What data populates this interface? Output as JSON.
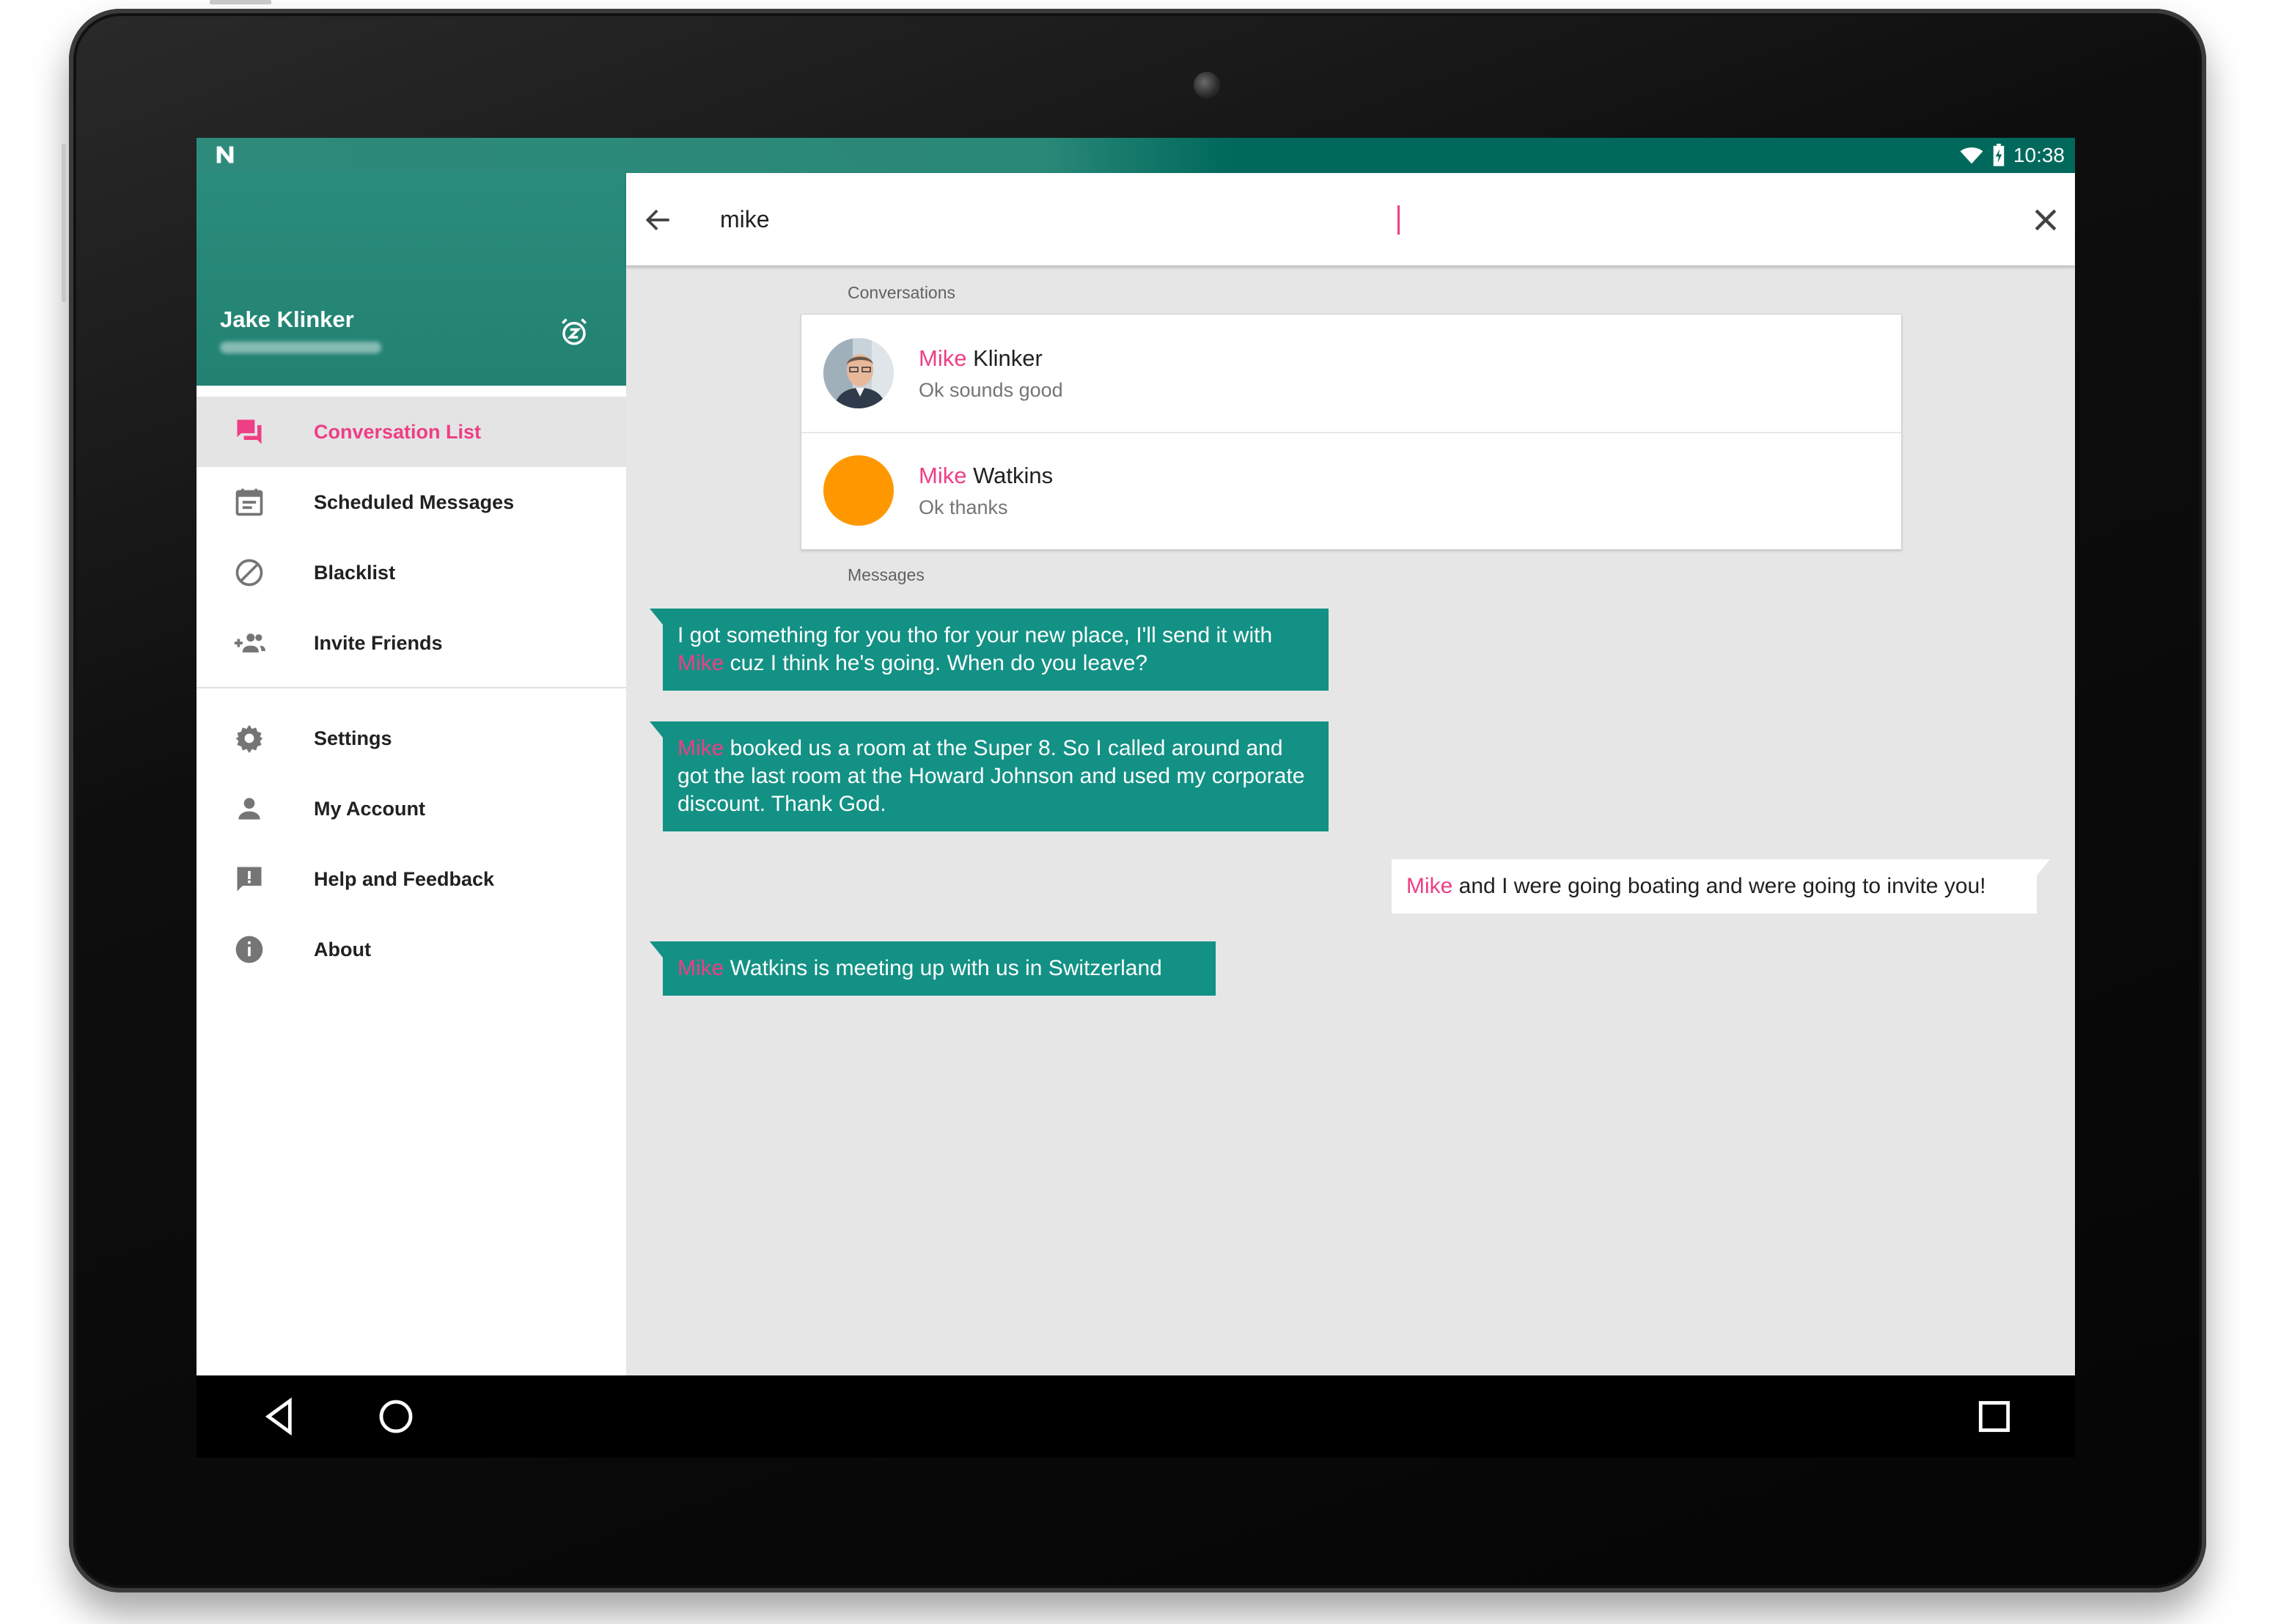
{
  "status_bar": {
    "time": "10:38"
  },
  "drawer": {
    "user_name": "Jake Klinker",
    "items": [
      {
        "label": "Conversation List",
        "icon": "forum-icon",
        "active": true
      },
      {
        "label": "Scheduled Messages",
        "icon": "calendar-icon"
      },
      {
        "label": "Blacklist",
        "icon": "block-icon"
      },
      {
        "label": "Invite Friends",
        "icon": "group-add-icon"
      }
    ],
    "items2": [
      {
        "label": "Settings",
        "icon": "gear-icon"
      },
      {
        "label": "My Account",
        "icon": "person-icon"
      },
      {
        "label": "Help and Feedback",
        "icon": "feedback-icon"
      },
      {
        "label": "About",
        "icon": "info-icon"
      }
    ]
  },
  "search": {
    "query": "mike"
  },
  "sections": {
    "conversations": "Conversations",
    "messages": "Messages"
  },
  "conversations": [
    {
      "name_highlight": "Mike",
      "name_rest": " Klinker",
      "snippet": "Ok sounds good"
    },
    {
      "name_highlight": "Mike",
      "name_rest": " Watkins",
      "snippet": "Ok thanks"
    }
  ],
  "messages": [
    {
      "pre": "I got something for you tho for your new place, I'll send it with ",
      "hl": "Mike",
      "post": " cuz I think he's going. When do you leave?"
    },
    {
      "pre": "",
      "hl": "Mike",
      "post": " booked us a room at the Super 8. So I called around and got the last room at the Howard Johnson and used my corporate discount. Thank God."
    },
    {
      "pre": "",
      "hl": "Mike",
      "post": " and I were going boating and were going to invite you!"
    },
    {
      "pre": "",
      "hl": "Mike",
      "post": " Watkins is meeting up with us in Switzerland"
    }
  ],
  "colors": {
    "accent": "#ee3e85",
    "primary": "#139185",
    "avatar_orange": "#ff9800"
  }
}
